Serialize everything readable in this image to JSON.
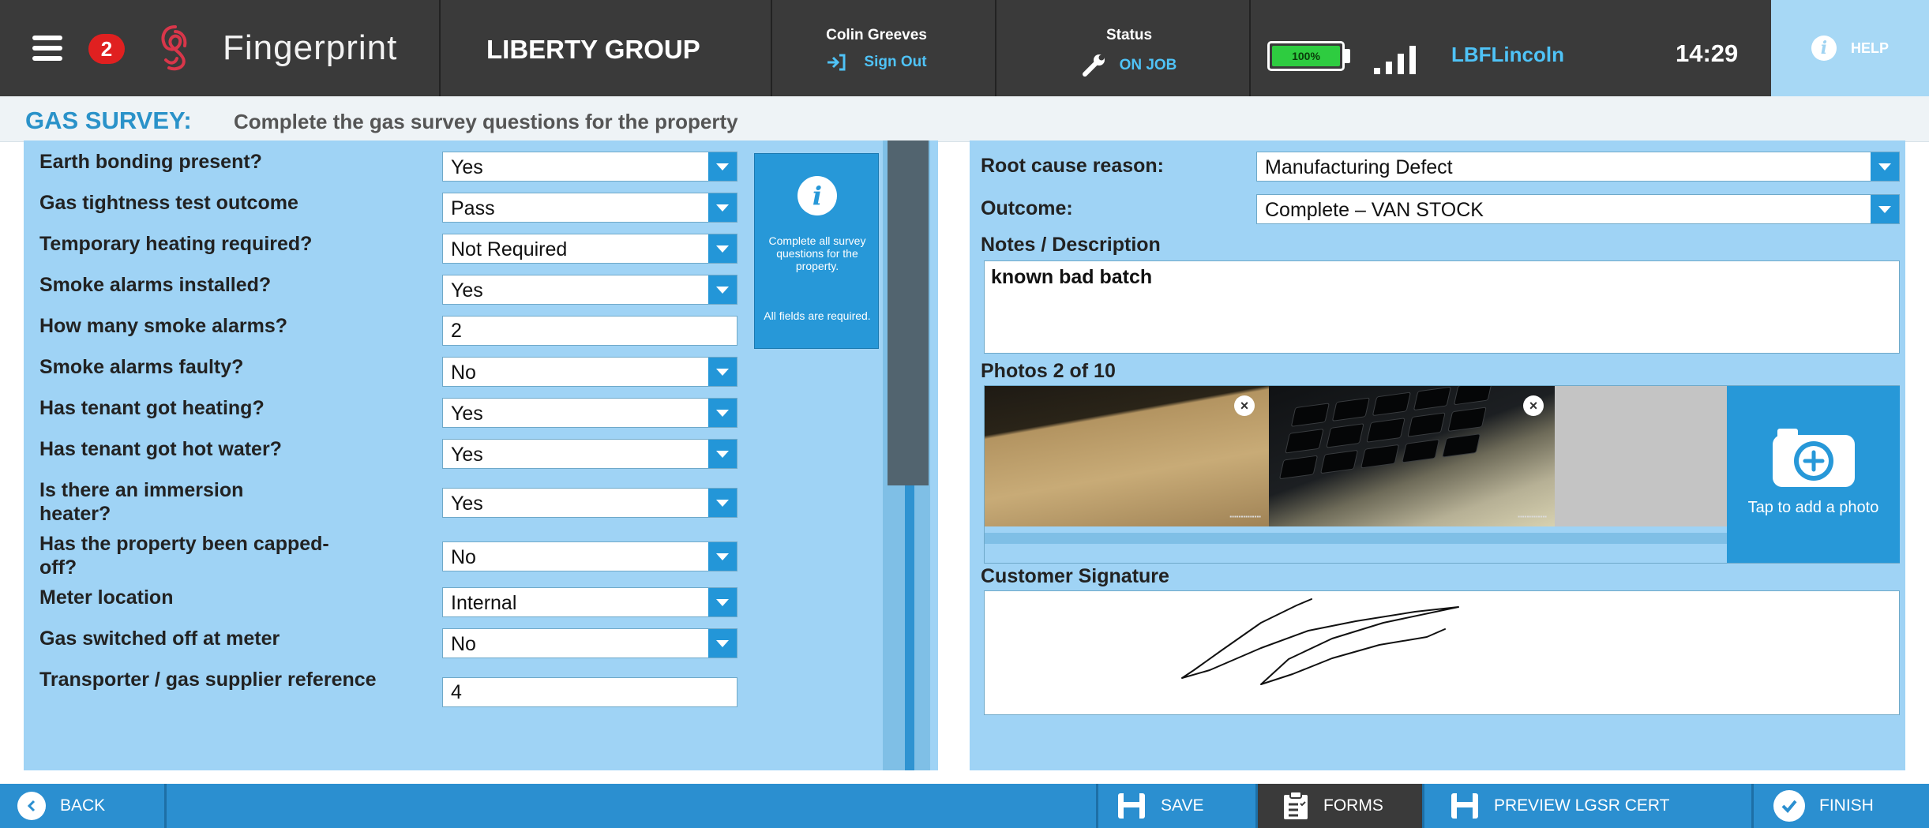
{
  "header": {
    "notification_count": "2",
    "app_name": "Fingerprint",
    "company": "LIBERTY GROUP",
    "user_name": "Colin Greeves",
    "sign_out_label": "Sign Out",
    "status_title": "Status",
    "status_value": "ON JOB",
    "battery_label": "100%",
    "battery_level": 100,
    "network_name": "LBFLincoln",
    "time": "14:29",
    "help_label": "HELP"
  },
  "page": {
    "title": "GAS SURVEY:",
    "subtitle": "Complete the gas survey questions for the property"
  },
  "survey": {
    "questions": [
      {
        "label": "Earth bonding present?",
        "value": "Yes"
      },
      {
        "label": "Gas tightness test outcome",
        "value": "Pass"
      },
      {
        "label": "Temporary heating required?",
        "value": "Not Required"
      },
      {
        "label": "Smoke alarms installed?",
        "value": "Yes"
      },
      {
        "label": "How many smoke alarms?",
        "value": "2"
      },
      {
        "label": "Smoke alarms faulty?",
        "value": "No"
      },
      {
        "label": "Has tenant got heating?",
        "value": "Yes"
      },
      {
        "label": "Has tenant got hot water?",
        "value": "Yes"
      },
      {
        "label": "Is there an immersion heater?",
        "value": "Yes"
      },
      {
        "label": "Has the property been capped-off?",
        "value": "No"
      },
      {
        "label": "Meter location",
        "value": "Internal"
      },
      {
        "label": "Gas switched off at meter",
        "value": "No"
      },
      {
        "label": "Transporter / gas supplier reference",
        "value": "4"
      }
    ],
    "info_text": "Complete all survey questions for the property.",
    "info_required": "All fields are required."
  },
  "details": {
    "root_cause_label": "Root cause reason:",
    "root_cause_value": "Manufacturing Defect",
    "outcome_label": "Outcome:",
    "outcome_value": "Complete – VAN STOCK",
    "notes_label": "Notes / Description",
    "notes_value": "known bad batch",
    "photos_label": "Photos 2 of 10",
    "add_photo_label": "Tap to add a photo",
    "signature_label": "Customer Signature"
  },
  "footer": {
    "back_label": "BACK",
    "save_label": "SAVE",
    "forms_label": "FORMS",
    "preview_label": "PREVIEW LGSR CERT",
    "finish_label": "FINISH"
  },
  "colors": {
    "header_bg": "#3a3a3a",
    "accent_blue": "#2798d8",
    "panel_bg": "#9fd3f5",
    "title_blue": "#2a92c9",
    "status_text": "#4fc3f7",
    "badge_red": "#e02020",
    "battery_green": "#2ecc40"
  }
}
